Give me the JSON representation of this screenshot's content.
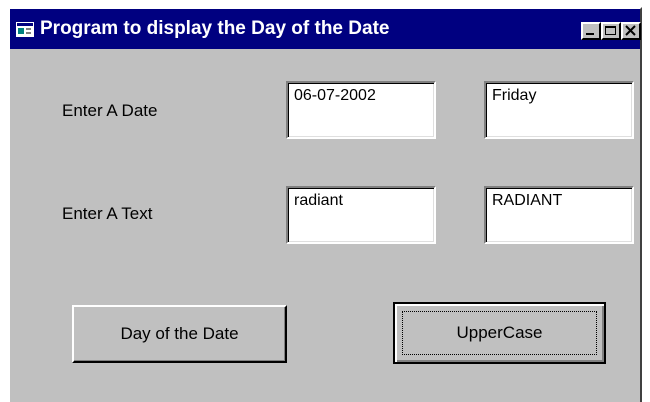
{
  "window": {
    "title": "Program to display the Day of the Date",
    "icon": "app-window-icon",
    "controls": [
      "minimize-icon",
      "maximize-icon",
      "close-icon"
    ]
  },
  "form": {
    "date_label": "Enter A Date",
    "date_value": "06-07-2002",
    "day_value": "Friday",
    "text_label": "Enter A Text",
    "text_value": "radiant",
    "upper_value": "RADIANT"
  },
  "buttons": {
    "day_of_date": "Day of the Date",
    "uppercase": "UpperCase"
  },
  "colors": {
    "titlebar": "#000080",
    "face": "#c0c0c0"
  }
}
